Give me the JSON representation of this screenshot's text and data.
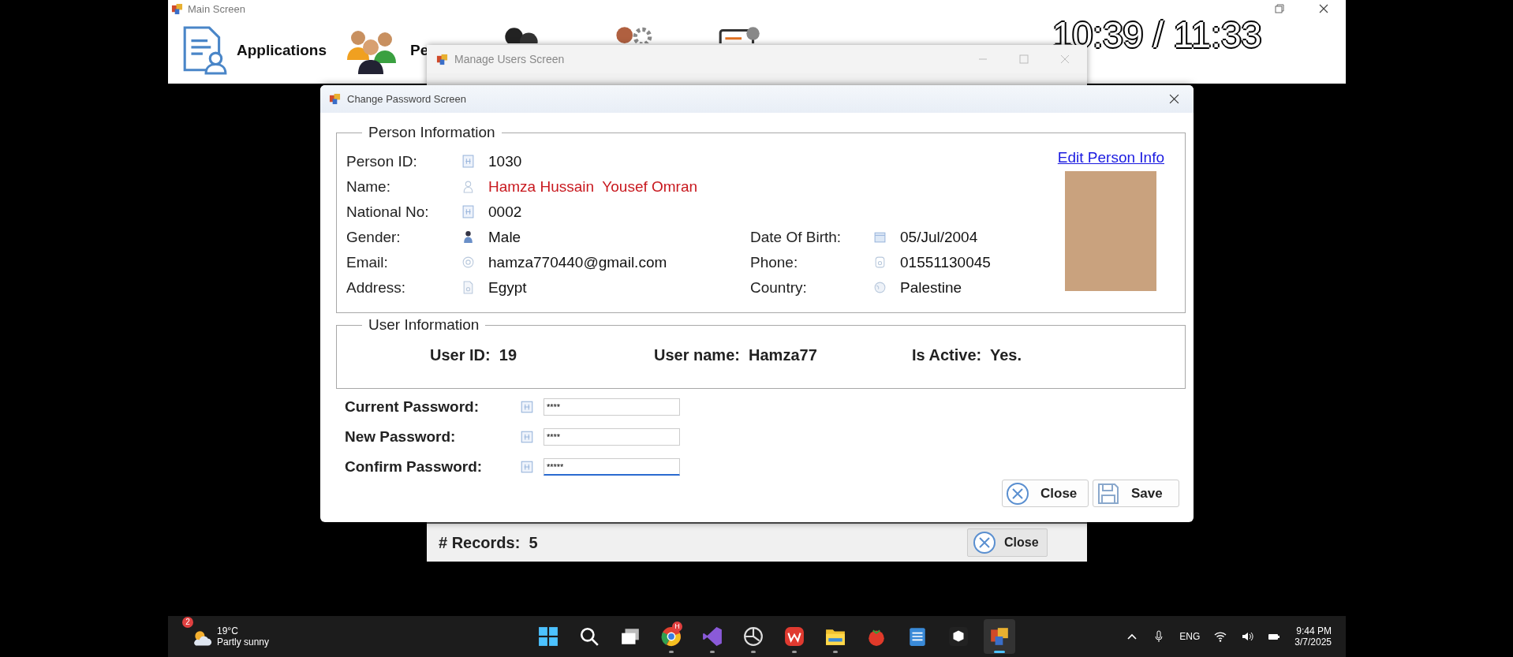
{
  "main_window": {
    "title": "Main Screen",
    "toolbar": [
      {
        "kind": "applications",
        "label": "Applications"
      },
      {
        "kind": "people",
        "label": "Pe"
      },
      {
        "kind": "users"
      },
      {
        "kind": "user-settings"
      },
      {
        "kind": "license"
      }
    ]
  },
  "video_time": "10:39 / 11:33",
  "manage_users": {
    "title": "Manage Users Screen",
    "records_label": "# Records:",
    "records_count": "5",
    "close_button": "Close"
  },
  "dialog": {
    "title": "Change Password Screen",
    "person_info": {
      "legend": "Person Information",
      "edit_link": "Edit Person Info",
      "left_fields": [
        {
          "kind": "id",
          "label": "Person ID:",
          "value": "1030",
          "emphasis": false
        },
        {
          "kind": "person",
          "label": "Name:",
          "value": "Hamza Hussain  Yousef Omran",
          "emphasis": true
        },
        {
          "kind": "id",
          "label": "National No:",
          "value": "0002",
          "emphasis": false
        },
        {
          "kind": "gender",
          "label": "Gender:",
          "value": "Male",
          "emphasis": false
        },
        {
          "kind": "email",
          "label": "Email:",
          "value": "hamza770440@gmail.com",
          "emphasis": false
        },
        {
          "kind": "address",
          "label": "Address:",
          "value": "Egypt",
          "emphasis": false
        }
      ],
      "right_fields": [
        {
          "kind": "calendar",
          "label": "Date Of Birth:",
          "value": "05/Jul/2004"
        },
        {
          "kind": "phone",
          "label": "Phone:",
          "value": "01551130045"
        },
        {
          "kind": "globe",
          "label": "Country:",
          "value": "Palestine"
        }
      ]
    },
    "user_info": {
      "legend": "User Information",
      "items": [
        {
          "label": "User ID:",
          "value": "19"
        },
        {
          "label": "User name:",
          "value": "Hamza77"
        },
        {
          "label": "Is Active:",
          "value": "Yes."
        }
      ]
    },
    "password_fields": [
      {
        "label": "Current Password:",
        "value": "****",
        "focused": false
      },
      {
        "label": "New Password:",
        "value": "****",
        "focused": false
      },
      {
        "label": "Confirm Password:",
        "value": "*****",
        "focused": true
      }
    ],
    "buttons": [
      {
        "kind": "close",
        "label": "Close"
      },
      {
        "kind": "save",
        "label": "Save"
      }
    ]
  },
  "taskbar": {
    "weather": {
      "badge": "2",
      "temperature": "19°C",
      "condition": "Partly sunny"
    },
    "apps": [
      {
        "kind": "start",
        "running": false,
        "selected": false
      },
      {
        "kind": "search",
        "running": false,
        "selected": false
      },
      {
        "kind": "task-view",
        "running": false,
        "selected": false
      },
      {
        "kind": "browser",
        "badge": "H",
        "running": true,
        "selected": false
      },
      {
        "kind": "ide",
        "running": true,
        "selected": false
      },
      {
        "kind": "aperture",
        "running": true,
        "selected": false
      },
      {
        "kind": "office",
        "running": true,
        "selected": false
      },
      {
        "kind": "folder",
        "running": true,
        "selected": false
      },
      {
        "kind": "tomato",
        "running": false,
        "selected": false
      },
      {
        "kind": "notepad",
        "running": false,
        "selected": false
      },
      {
        "kind": "cube",
        "running": false,
        "selected": false
      },
      {
        "kind": "app",
        "running": true,
        "selected": true
      }
    ],
    "language": "ENG",
    "time": "9:44 PM",
    "date": "3/7/2025"
  }
}
